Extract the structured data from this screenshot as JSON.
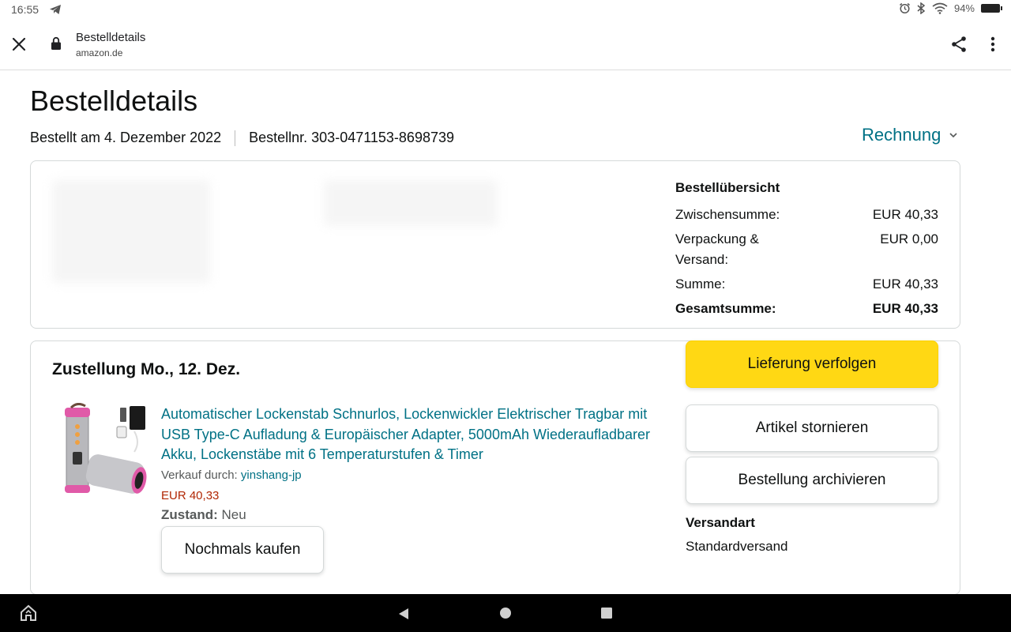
{
  "status_bar": {
    "time": "16:55",
    "battery": "94%",
    "icons": [
      "telegram-icon",
      "alarm-icon",
      "bluetooth-icon",
      "wifi-icon",
      "battery-icon"
    ]
  },
  "toolbar": {
    "title": "Bestelldetails",
    "domain": "amazon.de"
  },
  "page": {
    "title": "Bestelldetails",
    "ordered_on": "Bestellt am 4. Dezember 2022",
    "order_number": "Bestellnr. 303-0471153-8698739",
    "invoice_label": "Rechnung"
  },
  "summary": {
    "heading": "Bestellübersicht",
    "rows": [
      {
        "label": "Zwischensumme:",
        "value": "EUR 40,33"
      },
      {
        "label": "Verpackung & Versand:",
        "value": "EUR 0,00"
      },
      {
        "label": "Summe:",
        "value": "EUR 40,33"
      },
      {
        "label": "Gesamtsumme:",
        "value": "EUR 40,33"
      }
    ]
  },
  "shipment": {
    "title": "Zustellung Mo., 12. Dez.",
    "product_title": "Automatischer Lockenstab Schnurlos, Lockenwickler Elektrischer Tragbar mit USB Type-C Aufladung & Europäischer Adapter, 5000mAh Wiederaufladbarer Akku, Lockenstäbe mit 6 Temperaturstufen & Timer",
    "seller_label": "Verkauf durch:",
    "seller_name": "yinshang-jp",
    "price": "EUR 40,33",
    "condition_label": "Zustand:",
    "condition_value": "Neu",
    "rebuy_label": "Nochmals kaufen",
    "track_label": "Lieferung verfolgen",
    "cancel_label": "Artikel stornieren",
    "archive_label": "Bestellung archivieren",
    "shipping_method_label": "Versandart",
    "shipping_method_value": "Standardversand"
  },
  "colors": {
    "link": "#007185",
    "primary_button": "#ffd814",
    "price": "#b12704"
  }
}
